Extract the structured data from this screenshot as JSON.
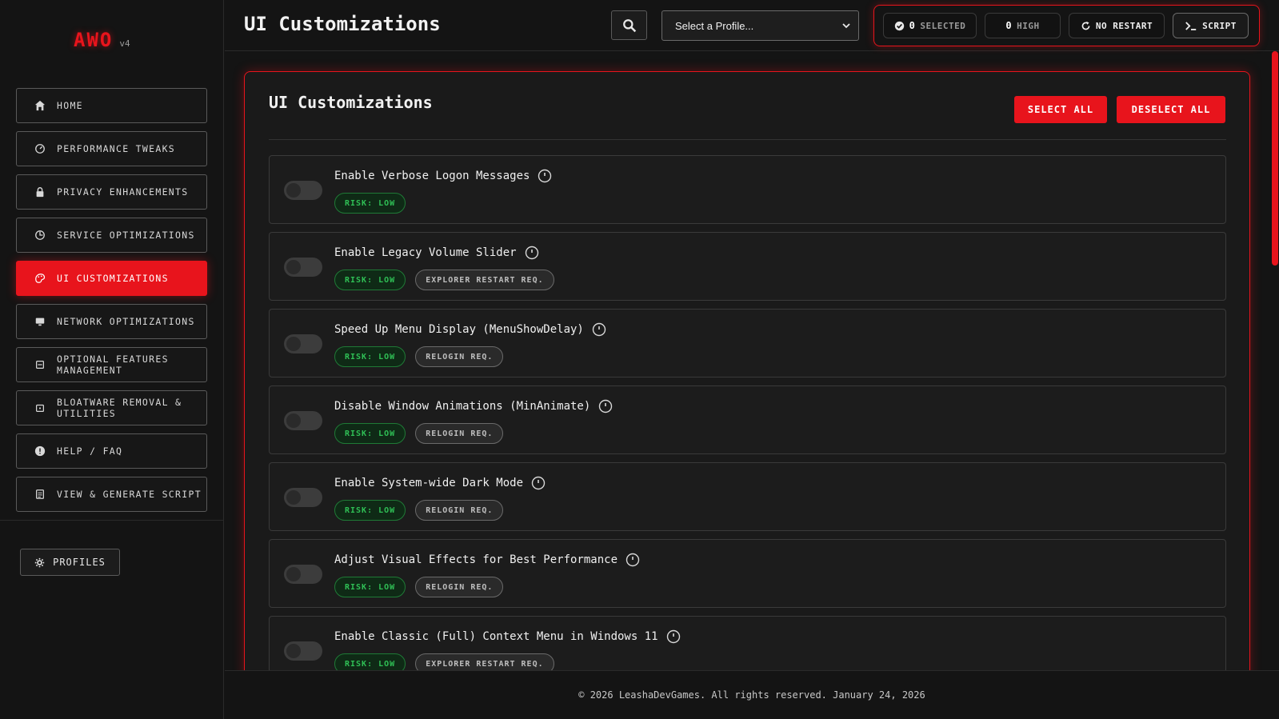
{
  "app": {
    "logo": "AWO",
    "version": "v4",
    "page_title": "UI Customizations"
  },
  "sidebar": {
    "items": [
      {
        "label": "HOME",
        "icon": "home-icon"
      },
      {
        "label": "PERFORMANCE TWEAKS",
        "icon": "gauge-icon"
      },
      {
        "label": "PRIVACY ENHANCEMENTS",
        "icon": "lock-icon"
      },
      {
        "label": "SERVICE OPTIMIZATIONS",
        "icon": "services-icon"
      },
      {
        "label": "UI CUSTOMIZATIONS",
        "icon": "palette-icon",
        "active": true
      },
      {
        "label": "NETWORK OPTIMIZATIONS",
        "icon": "network-icon"
      },
      {
        "label": "OPTIONAL FEATURES MANAGEMENT",
        "icon": "features-icon"
      },
      {
        "label": "BLOATWARE REMOVAL & UTILITIES",
        "icon": "trash-icon"
      },
      {
        "label": "HELP / FAQ",
        "icon": "help-icon"
      },
      {
        "label": "VIEW & GENERATE SCRIPT",
        "icon": "script-file-icon"
      }
    ],
    "profiles_label": "PROFILES"
  },
  "header": {
    "profile_select_value": "Select a Profile...",
    "stats": {
      "selected_count": "0",
      "selected_label": "SELECTED",
      "high_count": "0",
      "high_label": "HIGH",
      "restart_label": "NO RESTART",
      "script_label": "SCRIPT"
    }
  },
  "panel": {
    "title": "UI Customizations",
    "select_all": "SELECT ALL",
    "deselect_all": "DESELECT ALL",
    "tweaks": [
      {
        "title": "Enable Verbose Logon Messages",
        "risk": "RISK: LOW",
        "req": ""
      },
      {
        "title": "Enable Legacy Volume Slider",
        "risk": "RISK: LOW",
        "req": "EXPLORER RESTART REQ."
      },
      {
        "title": "Speed Up Menu Display (MenuShowDelay)",
        "risk": "RISK: LOW",
        "req": "RELOGIN REQ."
      },
      {
        "title": "Disable Window Animations (MinAnimate)",
        "risk": "RISK: LOW",
        "req": "RELOGIN REQ."
      },
      {
        "title": "Enable System-wide Dark Mode",
        "risk": "RISK: LOW",
        "req": "RELOGIN REQ."
      },
      {
        "title": "Adjust Visual Effects for Best Performance",
        "risk": "RISK: LOW",
        "req": "RELOGIN REQ."
      },
      {
        "title": "Enable Classic (Full) Context Menu in Windows 11",
        "risk": "RISK: LOW",
        "req": "EXPLORER RESTART REQ."
      }
    ]
  },
  "footer": {
    "text": "© 2026 LeashaDevGames. All rights reserved. January 24, 2026"
  },
  "colors": {
    "accent": "#e8141c",
    "background": "#141414",
    "risk_low": "#2fbf55"
  }
}
